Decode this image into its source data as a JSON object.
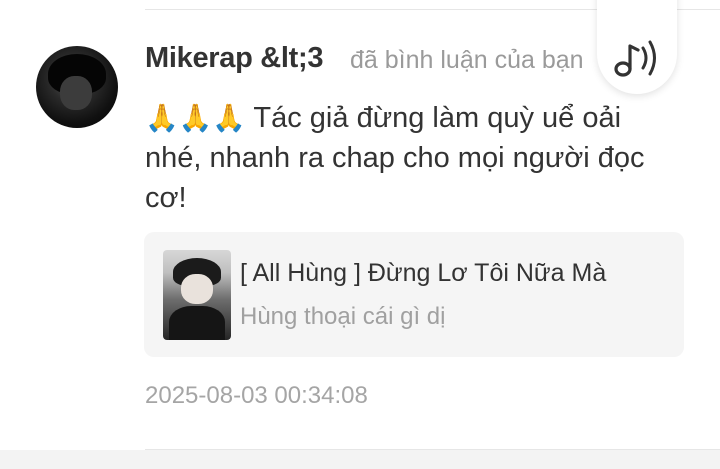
{
  "comment": {
    "username": "Mikerap &lt;3",
    "action": "đã bình luận của bạn",
    "emoji": "🙏🙏🙏",
    "text": "Tác giả đừng làm quỳ uể oải nhé, nhanh ra chap cho mọi người đọc cơ!",
    "timestamp": "2025-08-03 00:34:08"
  },
  "linked_story": {
    "title": "[ All Hùng ] Đừng Lơ Tôi Nữa Mà",
    "subtitle": "Hùng thoại cái gì dị"
  },
  "icons": {
    "audio": "music-note-sound-icon"
  }
}
